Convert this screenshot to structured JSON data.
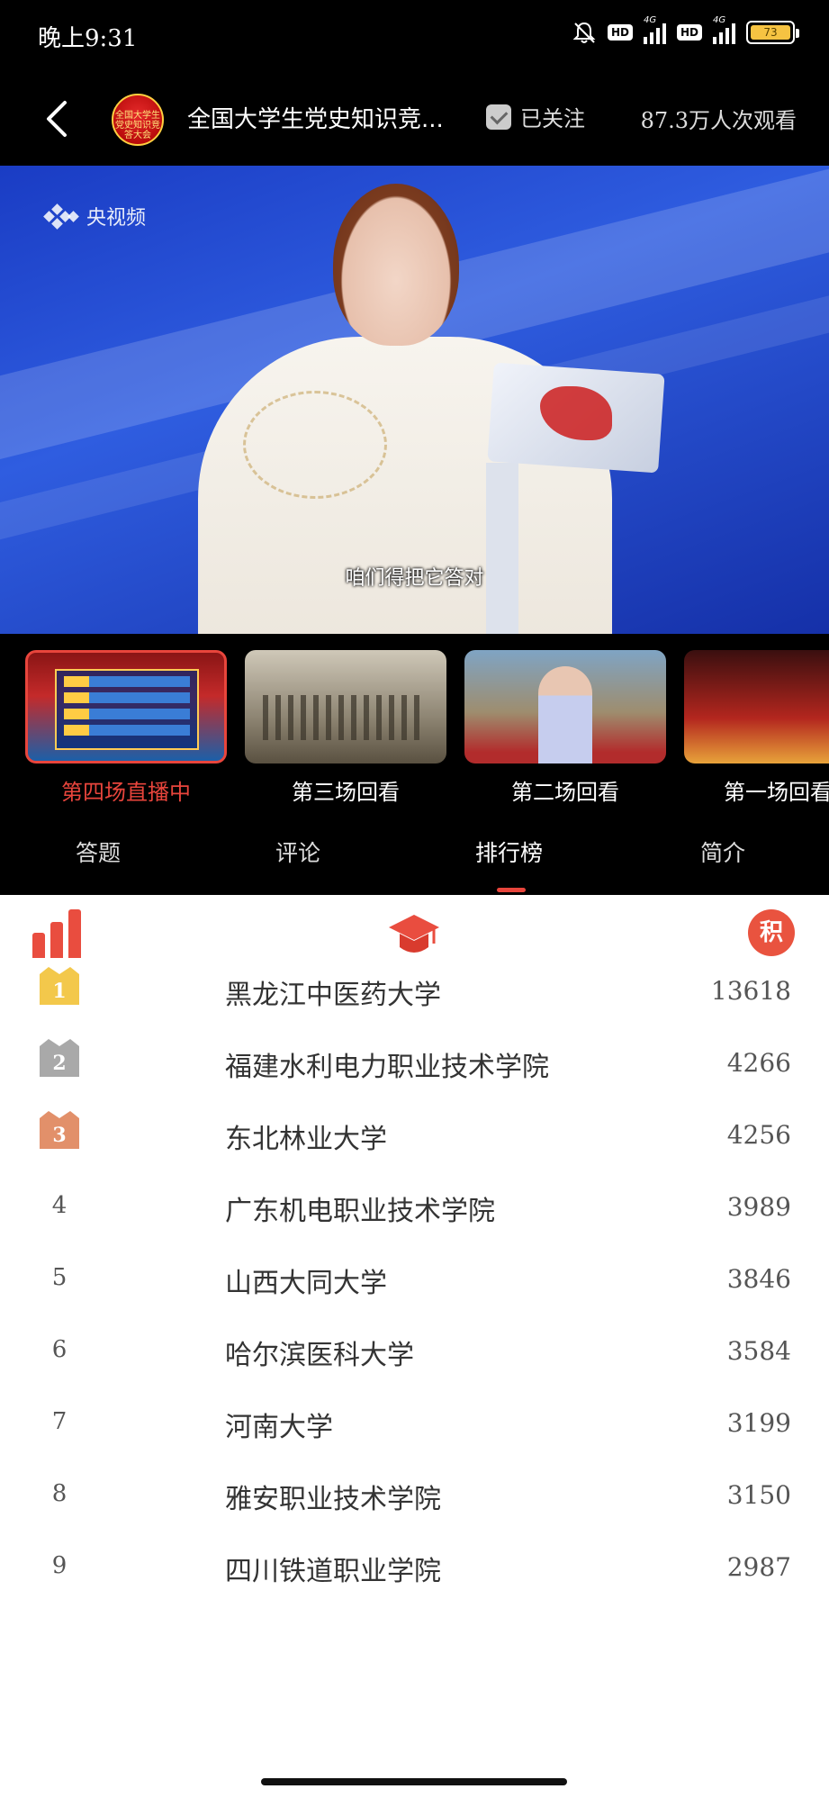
{
  "status_bar": {
    "time": "晚上9:31",
    "hd1": "HD",
    "hd2": "HD",
    "net1": "4G",
    "net2": "4G",
    "battery": "73"
  },
  "header": {
    "channel_logo_text": "全国大学生党史知识竞答大会",
    "title": "全国大学生党史知识竞...",
    "follow_label": "已关注",
    "viewers": "87.3万人次观看"
  },
  "video": {
    "watermark": "央视频",
    "subtitle": "咱们得把它答对"
  },
  "episodes": [
    {
      "label": "第四场直播中",
      "active": true
    },
    {
      "label": "第三场回看",
      "active": false
    },
    {
      "label": "第二场回看",
      "active": false
    },
    {
      "label": "第一场回看",
      "active": false
    }
  ],
  "tabs": [
    {
      "label": "答题"
    },
    {
      "label": "评论"
    },
    {
      "label": "排行榜",
      "active": true
    },
    {
      "label": "简介"
    }
  ],
  "ranking": {
    "points_icon": "积",
    "rows": [
      {
        "rank": "1",
        "school": "黑龙江中医药大学",
        "score": "13618",
        "medal": "gold"
      },
      {
        "rank": "2",
        "school": "福建水利电力职业技术学院",
        "score": "4266",
        "medal": "silver"
      },
      {
        "rank": "3",
        "school": "东北林业大学",
        "score": "4256",
        "medal": "bronze"
      },
      {
        "rank": "4",
        "school": "广东机电职业技术学院",
        "score": "3989"
      },
      {
        "rank": "5",
        "school": "山西大同大学",
        "score": "3846"
      },
      {
        "rank": "6",
        "school": "哈尔滨医科大学",
        "score": "3584"
      },
      {
        "rank": "7",
        "school": "河南大学",
        "score": "3199"
      },
      {
        "rank": "8",
        "school": "雅安职业技术学院",
        "score": "3150"
      },
      {
        "rank": "9",
        "school": "四川铁道职业学院",
        "score": "2987"
      }
    ]
  },
  "colors": {
    "accent": "#e8453c",
    "gold": "#f3c84b",
    "silver": "#a9a9a9",
    "bronze": "#e2906a"
  }
}
